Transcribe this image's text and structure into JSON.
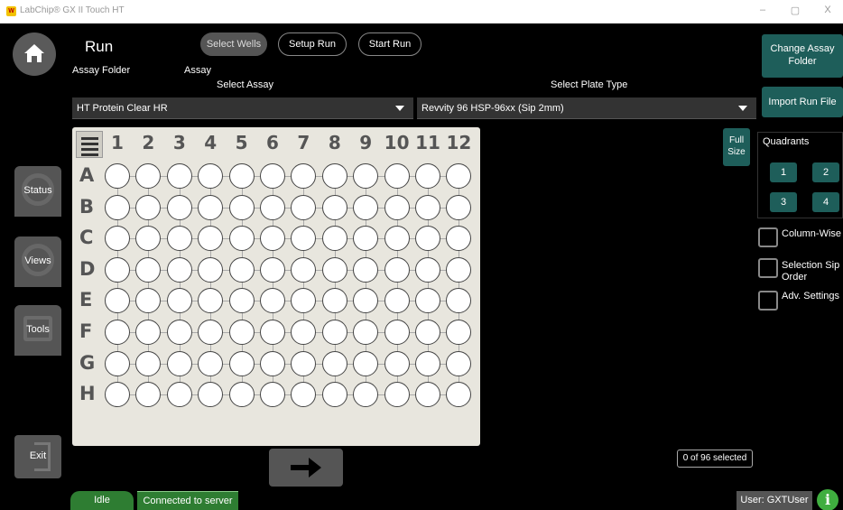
{
  "window": {
    "title": "LabChip® GX II Touch HT",
    "logo_text": "W",
    "minimize": "–",
    "maximize": "▢",
    "close": "X"
  },
  "nav": {
    "status": "Status",
    "views": "Views",
    "tools": "Tools",
    "exit": "Exit"
  },
  "header": {
    "title": "Run",
    "assay_folder_label": "Assay Folder",
    "assay_label": "Assay",
    "tabs": [
      "Select Wells",
      "Setup Run",
      "Start Run"
    ],
    "active_tab": "Select Wells"
  },
  "selectors": {
    "assay_label": "Select Assay",
    "assay_value": "HT Protein Clear HR",
    "plate_label": "Select Plate Type",
    "plate_value": "Revvity 96 HSP-96xx  (Sip 2mm)"
  },
  "plate": {
    "columns": [
      "1",
      "2",
      "3",
      "4",
      "5",
      "6",
      "7",
      "8",
      "9",
      "10",
      "11",
      "12"
    ],
    "rows": [
      "A",
      "B",
      "C",
      "D",
      "E",
      "F",
      "G",
      "H"
    ]
  },
  "full_size_label": "Full Size",
  "right_panel": {
    "change_assay_folder": "Change Assay Folder",
    "import_run_file": "Import Run File",
    "quadrants_label": "Quadrants",
    "quadrants": [
      "1",
      "2",
      "3",
      "4"
    ],
    "column_wise": "Column-Wise",
    "selection_sip_order": "Selection Sip Order",
    "adv_settings": "Adv. Settings"
  },
  "selection_count": "0 of 96 selected",
  "status": {
    "state": "Idle",
    "connection": "Connected to server",
    "user": "User: GXTUser"
  },
  "colors": {
    "teal_button": "#1e5e5a",
    "status_green": "#2e7d32",
    "plate_bg": "#e8e6de"
  }
}
